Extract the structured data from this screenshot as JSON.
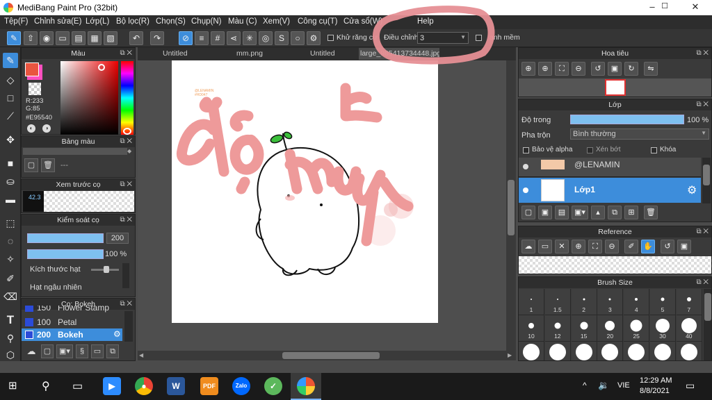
{
  "app": {
    "title": "MediBang Paint Pro (32bit)"
  },
  "window_controls": {
    "minimize": "–",
    "maximize": "☐",
    "close": "✕"
  },
  "menu": [
    "Tệp(F)",
    "Chỉnh sửa(E)",
    "Lớp(L)",
    "Bộ lọc(R)",
    "Chọn(S)",
    "Chụp(N)",
    "Màu (C)",
    "Xem(V)",
    "Công cụ(T)",
    "Cửa sổ(W)",
    "Help"
  ],
  "toolbar": {
    "antialias_label": "Khử răng cư",
    "adjust_label": "Điều chỉnh",
    "adjust_value": "3",
    "smooth_label": "anh mềm"
  },
  "color_panel": {
    "title": "Màu",
    "r": "R:233",
    "g": "G:85",
    "hex": "#E95540",
    "primary": "#E95540"
  },
  "palette_panel": {
    "title": "Bảng màu",
    "placeholder": "---"
  },
  "brush_preview": {
    "title": "Xem trước cọ",
    "value": "42.3"
  },
  "brush_control": {
    "title": "Kiểm soát cọ",
    "size": "200",
    "opacity": "100 %",
    "dot_size_label": "Kích thước hạt",
    "random_label": "Hạt ngẫu nhiên"
  },
  "brush_list": {
    "title": "Cọ: Bokeh",
    "items": [
      {
        "size": "150",
        "name": "Flower Stamp"
      },
      {
        "size": "100",
        "name": "Petal"
      },
      {
        "size": "200",
        "name": "Bokeh"
      }
    ]
  },
  "tabs": [
    "Untitled",
    "mm.png",
    "Untitled",
    "large_985413734448.jpg"
  ],
  "canvas": {
    "watermark_line1": "@LENAMIN",
    "watermark_line2": "#HD047",
    "scribble_text": "đỗ mượt",
    "scribble_corner": "k"
  },
  "navigator": {
    "title": "Hoa tiêu"
  },
  "layer_panel": {
    "title": "Lớp",
    "opacity_label": "Độ trong",
    "opacity_value": "100 %",
    "opacity_level": 1.0,
    "blend_label": "Pha trộn",
    "blend_value": "Bình thường",
    "protect_alpha": "Bảo vệ alpha",
    "clipping": "Xén bớt",
    "lock": "Khóa",
    "layers": [
      {
        "name": "@LENAMIN",
        "selected": false
      },
      {
        "name": "Lớp1",
        "selected": true
      }
    ]
  },
  "reference_panel": {
    "title": "Reference"
  },
  "brush_size_panel": {
    "title": "Brush Size",
    "sizes": [
      "1",
      "1.5",
      "2",
      "3",
      "4",
      "5",
      "7",
      "10",
      "12",
      "15",
      "20",
      "25",
      "30",
      "40"
    ]
  },
  "taskbar": {
    "language": "VIE",
    "time": "12:29 AM",
    "date": "8/8/2021"
  },
  "colors": {
    "accent": "#3d8ddb",
    "scribble": "#ee9a9a",
    "primary_color": "#E95540"
  }
}
